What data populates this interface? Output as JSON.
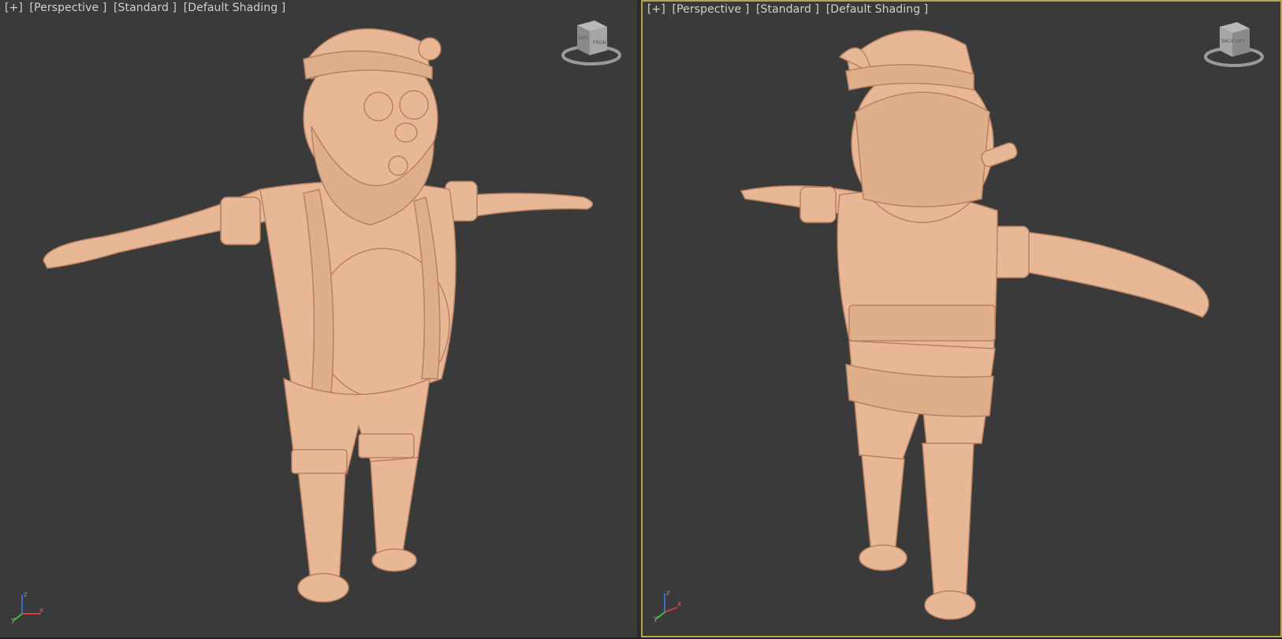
{
  "viewports": [
    {
      "id": "left",
      "labels": {
        "menu": "[+]",
        "view": "[Perspective ]",
        "style": "[Standard ]",
        "shading": "[Default Shading ]"
      },
      "viewcube": {
        "face_front": "FRONT",
        "face_side": "LEFT"
      },
      "active": false
    },
    {
      "id": "right",
      "labels": {
        "menu": "[+]",
        "view": "[Perspective ]",
        "style": "[Standard ]",
        "shading": "[Default Shading ]"
      },
      "viewcube": {
        "face_front": "BACK",
        "face_side": "LEFT"
      },
      "active": true
    }
  ],
  "axis_gizmo": {
    "x": "x",
    "y": "y",
    "z": "z"
  },
  "colors": {
    "viewport_bg": "#3a3a3a",
    "active_border": "#b8a24a",
    "model_skin": "#e8b795",
    "label_text": "#d0d0d0",
    "axis_x": "#d23c3c",
    "axis_y": "#3cc23c",
    "axis_z": "#3c6bd2"
  }
}
